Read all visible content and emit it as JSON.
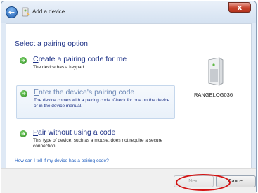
{
  "window": {
    "title": "Add a device",
    "close_glyph": "x",
    "back_glyph": "←"
  },
  "main": {
    "heading": "Select a pairing option",
    "options": [
      {
        "title_key": "C",
        "title_rest": "reate a pairing code for me",
        "description": "The device has a keypad."
      },
      {
        "title_key": "E",
        "title_rest": "nter the device's pairing code",
        "description": "The device comes with a pairing code. Check for one on the device or in the device manual."
      },
      {
        "title_key": "P",
        "title_rest": "air without using a code",
        "description": "This type of device, such as a mouse, does not require a secure connection."
      }
    ],
    "device": {
      "name": "RANGELOG036",
      "icon": "speaker-device-icon"
    },
    "help_link": "How can I tell if my device has a pairing code?"
  },
  "footer": {
    "next_label": "Next",
    "cancel_label": "Cancel"
  },
  "colors": {
    "heading": "#1e3287",
    "link": "#1c5bbd",
    "highlight_circle": "#d31313",
    "arrow": "#2e8a1f"
  }
}
